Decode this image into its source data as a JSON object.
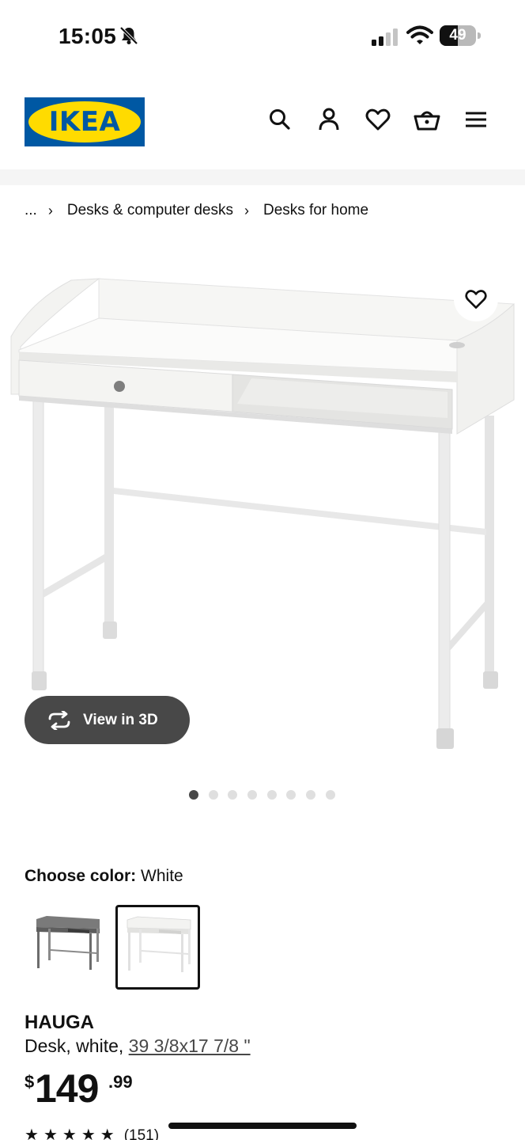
{
  "status_bar": {
    "time": "15:05",
    "battery_percent": "49",
    "battery_level": 0.49
  },
  "header": {
    "logo_text": "IKEA",
    "icons": [
      "search-icon",
      "account-icon",
      "heart-icon",
      "basket-icon",
      "menu-icon"
    ]
  },
  "breadcrumb": {
    "ellipsis": "...",
    "items": [
      "Desks & computer desks",
      "Desks for home"
    ]
  },
  "gallery": {
    "view_3d_label": "View in 3D",
    "dot_count": 8,
    "active_dot": 0
  },
  "color": {
    "label": "Choose color:",
    "selected": "White",
    "swatches": [
      "dark-gray-desk",
      "white-desk"
    ]
  },
  "product": {
    "name": "HAUGA",
    "desc_prefix": "Desk, white, ",
    "dimensions": "39 3/8x17 7/8 \"",
    "price_currency": "$",
    "price_int": "149",
    "price_dec": ".99",
    "rating_count": "(151)",
    "rating": 4.5
  },
  "colors": {
    "ikea_blue": "#0058a3",
    "ikea_yellow": "#ffdb00",
    "button_dark": "#484848"
  }
}
